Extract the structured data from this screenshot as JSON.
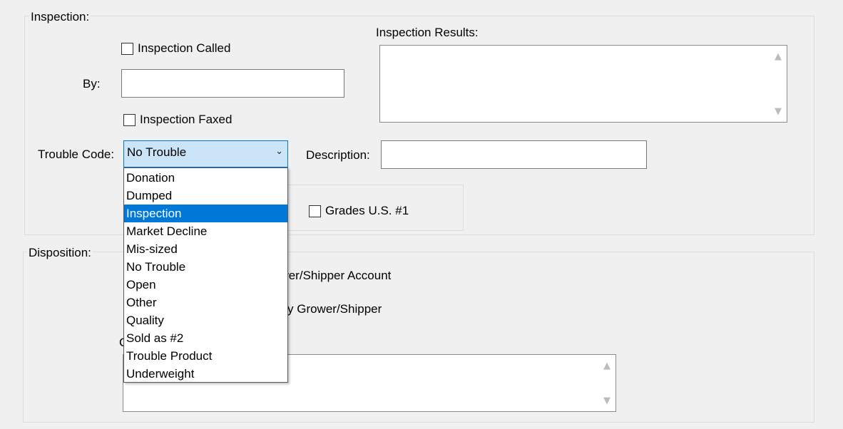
{
  "inspection": {
    "legend": "Inspection:",
    "inspection_called_label": "Inspection Called",
    "by_label": "By:",
    "by_value": "",
    "inspection_faxed_label": "Inspection Faxed",
    "results_label": "Inspection Results:",
    "results_value": "",
    "trouble_code_label": "Trouble Code:",
    "trouble_code_value": "No Trouble",
    "description_label": "Description:",
    "description_value": "",
    "grades_label": "Grades U.S. #1"
  },
  "disposition": {
    "legend": "Disposition:",
    "partial_1": "ower/Shipper Account",
    "partial_2": "y Grower/Shipper",
    "partial_3": "C",
    "comments_value": ""
  },
  "trouble_code_dropdown": {
    "items": [
      "Donation",
      "Dumped",
      "Inspection",
      "Market Decline",
      "Mis-sized",
      "No Trouble",
      "Open",
      "Other",
      "Quality",
      "Sold as #2",
      "Trouble Product",
      "Underweight"
    ],
    "highlighted": "Inspection"
  },
  "colors": {
    "highlight": "#0078d7",
    "combo_bg": "#cce4f7",
    "window_bg": "#f0f0f0"
  },
  "icons": {
    "scroll_up": "▲",
    "scroll_down": "▼",
    "combo_chevron": "⌄"
  }
}
